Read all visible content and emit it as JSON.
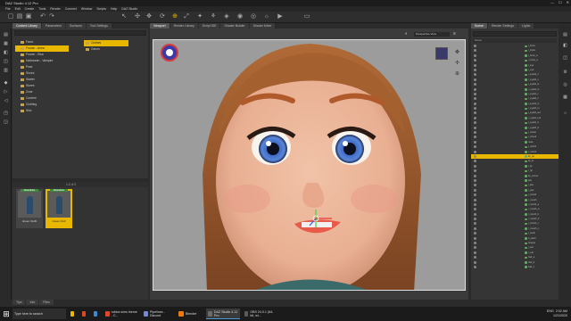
{
  "window": {
    "title": "DAZ Studio 4.12 Pro"
  },
  "menu": [
    "File",
    "Edit",
    "Create",
    "Tools",
    "Render",
    "Connect",
    "Window",
    "Scripts",
    "Help",
    "DAZ Studio"
  ],
  "left_tabs": [
    "Content Library",
    "Parameters",
    "Surfaces",
    "Tool Settings"
  ],
  "viewport_tabs": [
    "Viewport",
    "Render Library",
    "Script IDE",
    "Shader Builder",
    "Shader Mixer"
  ],
  "viewport_view": "Perspective View",
  "right_tabs": [
    "Scene",
    "Render Settings",
    "Lights"
  ],
  "tree": [
    {
      "label": "Favor",
      "sel": false
    },
    {
      "label": "Frozen - Anna",
      "sel": true
    },
    {
      "label": "Frozen - Elsa",
      "sel": false
    },
    {
      "label": "Halloween - Vampire",
      "sel": false
    },
    {
      "label": "Pose",
      "sel": false
    },
    {
      "label": "Shoes",
      "sel": false
    },
    {
      "label": "Starter",
      "sel": false
    },
    {
      "label": "Stores",
      "sel": false
    },
    {
      "label": "Zone",
      "sel": false
    },
    {
      "label": "Content",
      "sel": false
    },
    {
      "label": "Clothing",
      "sel": false
    },
    {
      "label": "Skin",
      "sel": false
    }
  ],
  "sub_list": [
    {
      "label": "Clothes",
      "sel": true
    },
    {
      "label": "Genes",
      "sel": false
    }
  ],
  "assets_bar": "1-2 of 2",
  "assets": [
    {
      "caption": "Green Outfit",
      "badge": "Wearables",
      "sel": false
    },
    {
      "caption": "Green Outf",
      "badge": "Wearables",
      "sel": true
    }
  ],
  "scene_header": "Name",
  "scene_rows": [
    {
      "label": "l_brow",
      "sel": false
    },
    {
      "label": "r_brow",
      "sel": false
    },
    {
      "label": "l_brow_a",
      "sel": false
    },
    {
      "label": "r_brow_a",
      "sel": false
    },
    {
      "label": "l_eye",
      "sel": false
    },
    {
      "label": "r_eye",
      "sel": false
    },
    {
      "label": "l_eyelid_u",
      "sel": false
    },
    {
      "label": "r_eyelid_u",
      "sel": false
    },
    {
      "label": "l_eyelid_lo",
      "sel": false
    },
    {
      "label": "r_eyelid_lo",
      "sel": false
    },
    {
      "label": "l_eyelid_c",
      "sel": false
    },
    {
      "label": "r_eyelid_c",
      "sel": false
    },
    {
      "label": "l_eyelid_in",
      "sel": false
    },
    {
      "label": "r_eyelid_in",
      "sel": false
    },
    {
      "label": "l_eyelid_out",
      "sel": false
    },
    {
      "label": "r_eyelid_out",
      "sel": false
    },
    {
      "label": "l_eyelid_d",
      "sel": false
    },
    {
      "label": "r_eyelid_d",
      "sel": false
    },
    {
      "label": "l_cheek",
      "sel": false
    },
    {
      "label": "r_cheek",
      "sel": false
    },
    {
      "label": "nose",
      "sel": false
    },
    {
      "label": "l_nostril",
      "sel": false
    },
    {
      "label": "r_nostril",
      "sel": false
    },
    {
      "label": "lip_up",
      "sel": true
    },
    {
      "label": "lip_lo",
      "sel": false
    },
    {
      "label": "l_lip",
      "sel": false
    },
    {
      "label": "r_lip",
      "sel": false
    },
    {
      "label": "lip_corner",
      "sel": false
    },
    {
      "label": "jaw",
      "sel": false
    },
    {
      "label": "l_jaw",
      "sel": false
    },
    {
      "label": "r_jaw",
      "sel": false
    },
    {
      "label": "l_mouth",
      "sel": false
    },
    {
      "label": "r_mouth",
      "sel": false
    },
    {
      "label": "l_mouth_a",
      "sel": false
    },
    {
      "label": "r_mouth_a",
      "sel": false
    },
    {
      "label": "l_mouth_b",
      "sel": false
    },
    {
      "label": "r_mouth_b",
      "sel": false
    },
    {
      "label": "l_mouth_c",
      "sel": false
    },
    {
      "label": "r_mouth_c",
      "sel": false
    },
    {
      "label": "t_teeth",
      "sel": false
    },
    {
      "label": "b_teeth",
      "sel": false
    },
    {
      "label": "tongue",
      "sel": false
    },
    {
      "label": "l_ear",
      "sel": false
    },
    {
      "label": "r_ear",
      "sel": false
    },
    {
      "label": "hair_a",
      "sel": false
    },
    {
      "label": "hair_b",
      "sel": false
    },
    {
      "label": "hair_c",
      "sel": false
    }
  ],
  "bottom_tabs": [
    "Tips",
    "Info",
    "Files"
  ],
  "taskbar": {
    "apps": [
      {
        "label": "Type here to search",
        "color": "#ffffff",
        "active": false
      },
      {
        "label": "",
        "color": "#e8b800",
        "active": false
      },
      {
        "label": "",
        "color": "#d84a2a",
        "active": false
      },
      {
        "label": "",
        "color": "#3a8ad8",
        "active": false
      },
      {
        "label": "roblox sims theme - C...",
        "color": "#d84a2a",
        "active": false
      },
      {
        "label": "Pipelines - Discord",
        "color": "#7289da",
        "active": false
      },
      {
        "label": "Blender",
        "color": "#e87d0d",
        "active": false
      },
      {
        "label": "DAZ Studio 4.12 Pro",
        "color": "#6a6a6a",
        "active": true
      },
      {
        "label": "OBS 24.0.1 (64-bit, wi...",
        "color": "#5a5a5a",
        "active": false
      }
    ],
    "lang": "ENG",
    "time": "2:02 AM",
    "date": "1/21/2020"
  },
  "colors": {
    "accent": "#e8b800",
    "panel": "#353535",
    "frame": "#2b2b2b"
  }
}
